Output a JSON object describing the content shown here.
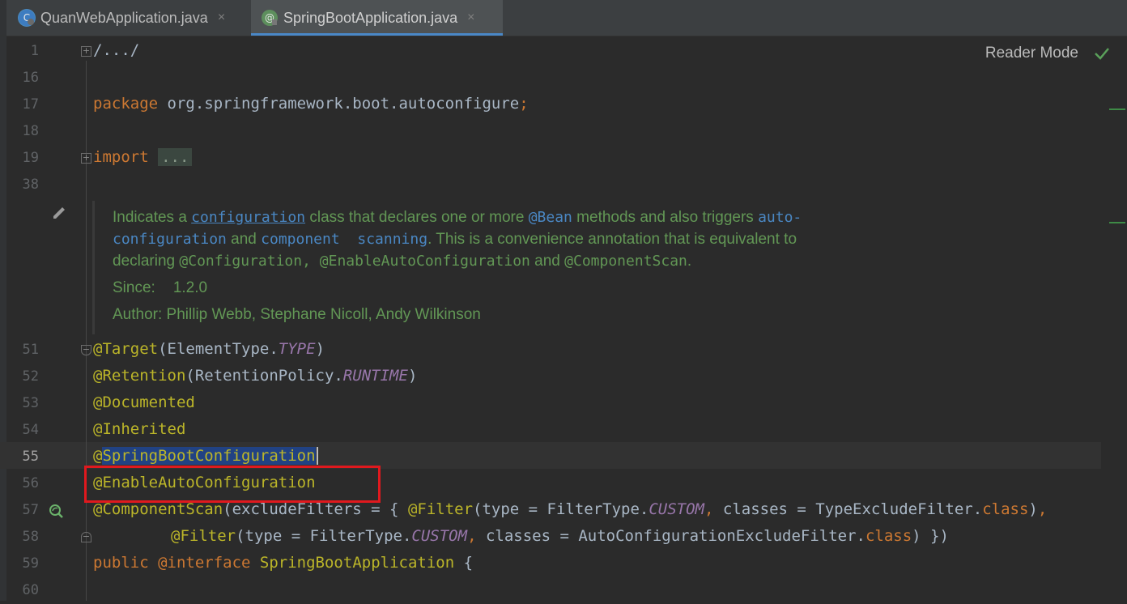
{
  "tabs": [
    {
      "label": "QuanWebApplication.java",
      "icon": "java-class-icon",
      "active": false
    },
    {
      "label": "SpringBootApplication.java",
      "icon": "annotation-icon",
      "active": true
    }
  ],
  "tab_close_glyph": "×",
  "reader_mode": "Reader Mode",
  "line_numbers": {
    "l1": "1",
    "l16": "16",
    "l17": "17",
    "l18": "18",
    "l19": "19",
    "l38": "38",
    "l51": "51",
    "l52": "52",
    "l53": "53",
    "l54": "54",
    "l55": "55",
    "l56": "56",
    "l57": "57",
    "l58": "58",
    "l59": "59",
    "l60": "60"
  },
  "code": {
    "folded_header": "/.../",
    "package_kw": "package",
    "package_name": " org.springframework.boot.autoconfigure",
    "semicolon": ";",
    "import_kw": "import",
    "import_folded": "...",
    "l51_ann": "@Target",
    "l51_rest": "(ElementType.",
    "l51_const": "TYPE",
    "l51_end": ")",
    "l52_ann": "@Retention",
    "l52_rest": "(RetentionPolicy.",
    "l52_const": "RUNTIME",
    "l52_end": ")",
    "l53": "@Documented",
    "l54": "@Inherited",
    "l55_at": "@",
    "l55_sel": "SpringBootConfiguration",
    "l56": "@EnableAutoConfiguration",
    "l57_ann": "@ComponentScan",
    "l57_a": "(excludeFilters = { ",
    "l57_filter": "@Filter",
    "l57_b": "(type = FilterType.",
    "l57_const": "CUSTOM",
    "l57_comma": ",",
    "l57_c": " classes = TypeExcludeFilter.",
    "l57_class": "class",
    "l57_d": ")",
    "l57_e": ",",
    "l58_filter": "@Filter",
    "l58_b": "(type = FilterType.",
    "l58_const": "CUSTOM",
    "l58_comma": ",",
    "l58_c": " classes = AutoConfigurationExcludeFilter.",
    "l58_class": "class",
    "l58_d": ") })",
    "l59_public": "public",
    "l59_iface": " @interface",
    "l59_name": " SpringBootApplication",
    "l59_brace": " {"
  },
  "javadoc": {
    "t1": "Indicates a ",
    "link_configuration": "configuration",
    "t2": " class that declares one or more ",
    "bean": "@Bean",
    "t3": " methods and also triggers ",
    "auto": "auto-",
    "auto2": "configuration",
    "t4": " and ",
    "component_scanning": "component  scanning",
    "t5": ". This is a convenience annotation that is equivalent to",
    "t6": "declaring ",
    "ann1": "@Configuration,",
    "ann2": " @EnableAutoConfiguration",
    "t7": " and ",
    "ann3": "@ComponentScan",
    "t8": ".",
    "since_label": "Since:",
    "since_value": "1.2.0",
    "author_label": "Author:",
    "author_value": "Phillip Webb, Stephane Nicoll, Andy Wilkinson"
  },
  "colors": {
    "keyword": "#cc7832",
    "annotation": "#bbb529",
    "constant": "#9876aa",
    "doc": "#629755",
    "link": "#4a87c3",
    "highlight_box": "#e0191e"
  }
}
